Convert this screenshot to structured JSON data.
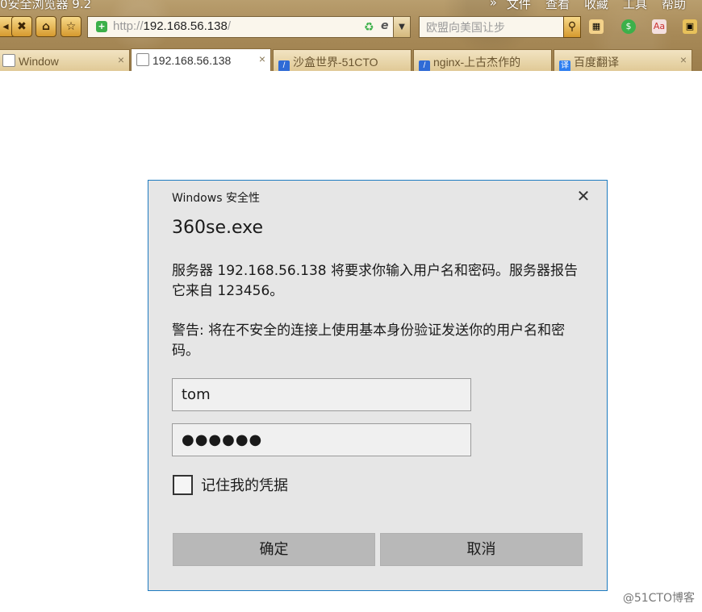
{
  "browser": {
    "title": "0安全浏览器 9.2",
    "menu": [
      "文件",
      "查看",
      "收藏",
      "工具",
      "帮助"
    ],
    "menu_chevron": "»",
    "address": {
      "scheme": "http://",
      "host": "192.168.56.138",
      "suffix": "/"
    },
    "search_placeholder": "欧盟向美国让步",
    "tabs": [
      {
        "label": "Window",
        "active": false
      },
      {
        "label": "192.168.56.138",
        "active": true
      },
      {
        "label": "沙盒世界-51CTO",
        "active": false
      },
      {
        "label": "nginx-上古杰作的",
        "active": false
      },
      {
        "label": "百度翻译",
        "active": false
      }
    ]
  },
  "dialog": {
    "title": "Windows 安全性",
    "app": "360se.exe",
    "message": "服务器 192.168.56.138 将要求你输入用户名和密码。服务器报告它来自 123456。",
    "warning": "警告: 将在不安全的连接上使用基本身份验证发送你的用户名和密码。",
    "username_value": "tom",
    "password_mask": "●●●●●●",
    "remember_label": "记住我的凭据",
    "remember_checked": false,
    "ok_label": "确定",
    "cancel_label": "取消"
  },
  "watermark": "@51CTO博客",
  "colors": {
    "dialog_border": "#1e7bc0",
    "dialog_bg": "#e6e6e6",
    "button_bg": "#b8b8b8"
  }
}
